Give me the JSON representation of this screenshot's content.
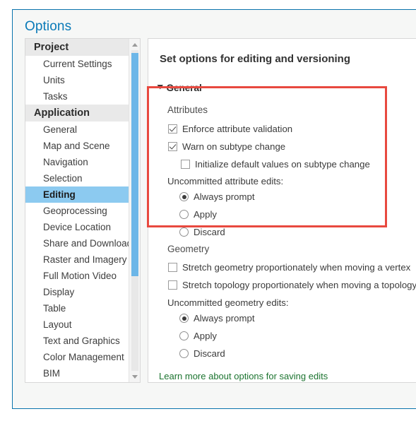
{
  "dialog": {
    "title": "Options",
    "accent_color": "#0a7ab8",
    "highlight_color": "#e8493f",
    "link_color": "#1c7430",
    "selection_color": "#8ccaf0"
  },
  "sidebar": {
    "scroll": {
      "up_icon": "scroll-up-arrow-icon",
      "down_icon": "scroll-down-arrow-icon"
    },
    "groups": [
      {
        "label": "Project",
        "items": [
          {
            "label": "Current Settings",
            "selected": false
          },
          {
            "label": "Units",
            "selected": false
          },
          {
            "label": "Tasks",
            "selected": false
          }
        ]
      },
      {
        "label": "Application",
        "items": [
          {
            "label": "General",
            "selected": false
          },
          {
            "label": "Map and Scene",
            "selected": false
          },
          {
            "label": "Navigation",
            "selected": false
          },
          {
            "label": "Selection",
            "selected": false
          },
          {
            "label": "Editing",
            "selected": true
          },
          {
            "label": "Geoprocessing",
            "selected": false
          },
          {
            "label": "Device Location",
            "selected": false
          },
          {
            "label": "Share and Download",
            "selected": false
          },
          {
            "label": "Raster and Imagery",
            "selected": false
          },
          {
            "label": "Full Motion Video",
            "selected": false
          },
          {
            "label": "Display",
            "selected": false
          },
          {
            "label": "Table",
            "selected": false
          },
          {
            "label": "Layout",
            "selected": false
          },
          {
            "label": "Text and Graphics",
            "selected": false
          },
          {
            "label": "Color Management",
            "selected": false
          },
          {
            "label": "BIM",
            "selected": false
          }
        ]
      }
    ]
  },
  "content": {
    "heading": "Set options for editing and versioning",
    "expander": {
      "label": "General",
      "icon": "chevron-down-icon",
      "expanded": true
    },
    "attributes": {
      "section_label": "Attributes",
      "checkboxes": [
        {
          "label": "Enforce attribute validation",
          "checked": true
        },
        {
          "label": "Warn on subtype change",
          "checked": true
        },
        {
          "label": "Initialize default values on subtype change",
          "checked": false
        }
      ],
      "uncommitted_label": "Uncommitted attribute edits:",
      "radios": [
        {
          "label": "Always prompt",
          "selected": true
        },
        {
          "label": "Apply",
          "selected": false
        },
        {
          "label": "Discard",
          "selected": false
        }
      ]
    },
    "geometry": {
      "section_label": "Geometry",
      "checkboxes": [
        {
          "label": "Stretch geometry proportionately when moving a vertex",
          "checked": false
        },
        {
          "label": "Stretch topology proportionately when moving a topology eleme",
          "checked": false
        }
      ],
      "uncommitted_label": "Uncommitted geometry edits:",
      "radios": [
        {
          "label": "Always prompt",
          "selected": true
        },
        {
          "label": "Apply",
          "selected": false
        },
        {
          "label": "Discard",
          "selected": false
        }
      ]
    },
    "learn_more_link": "Learn more about options for saving edits"
  }
}
